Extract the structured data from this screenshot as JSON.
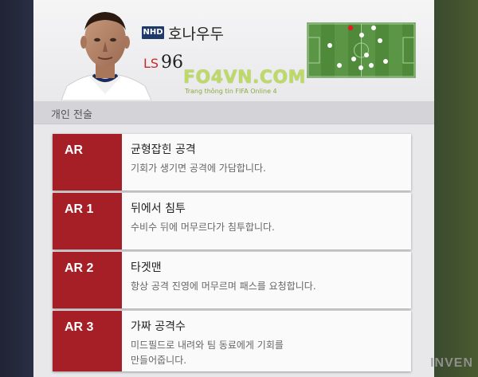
{
  "player": {
    "nation_code": "NHD",
    "name": "호나우두",
    "position": "LS",
    "rating": "96"
  },
  "watermark": {
    "site": "FO4VN.COM",
    "tagline": "Trang thông tin FIFA Online 4",
    "corner": "INVEN"
  },
  "section": {
    "title": "개인 전술"
  },
  "tactics": [
    {
      "code": "AR",
      "title": "균형잡힌 공격",
      "desc": "기회가 생기면 공격에 가담합니다."
    },
    {
      "code": "AR 1",
      "title": "뒤에서 침투",
      "desc": "수비수 뒤에 머무르다가 침투합니다."
    },
    {
      "code": "AR 2",
      "title": "타겟맨",
      "desc": "항상 공격 진영에 머무르며 패스를 요청합니다."
    },
    {
      "code": "AR 3",
      "title": "가짜 공격수",
      "desc": "미드필드로 내려와 팀 동료에게 기회를\n만들어줍니다."
    }
  ],
  "colors": {
    "accent": "#a61e26",
    "pitch": "#4f8a3a",
    "highlight_dot": "#e02020"
  }
}
